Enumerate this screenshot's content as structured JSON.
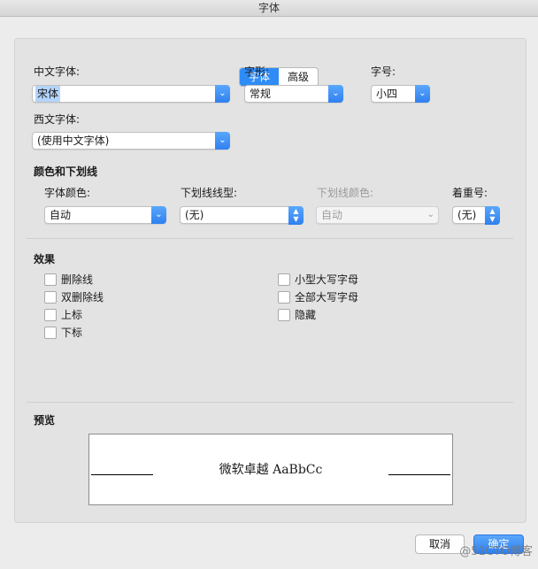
{
  "window": {
    "title": "字体"
  },
  "tabs": [
    {
      "label": "字体",
      "active": true
    },
    {
      "label": "高级",
      "active": false
    }
  ],
  "font": {
    "chinese_label": "中文字体:",
    "chinese_value": "宋体",
    "style_label": "字形:",
    "style_value": "常规",
    "size_label": "字号:",
    "size_value": "小四",
    "western_label": "西文字体:",
    "western_value": "(使用中文字体)"
  },
  "color_underline": {
    "section_title": "颜色和下划线",
    "font_color_label": "字体颜色:",
    "font_color_value": "自动",
    "underline_style_label": "下划线线型:",
    "underline_style_value": "(无)",
    "underline_color_label": "下划线颜色:",
    "underline_color_value": "自动",
    "emphasis_label": "着重号:",
    "emphasis_value": "(无)"
  },
  "effects": {
    "title": "效果",
    "left": [
      {
        "label": "删除线",
        "checked": false
      },
      {
        "label": "双删除线",
        "checked": false
      },
      {
        "label": "上标",
        "checked": false
      },
      {
        "label": "下标",
        "checked": false
      }
    ],
    "right": [
      {
        "label": "小型大写字母",
        "checked": false
      },
      {
        "label": "全部大写字母",
        "checked": false
      },
      {
        "label": "隐藏",
        "checked": false
      }
    ]
  },
  "preview": {
    "title": "预览",
    "sample_text": "微软卓越 AaBbCc"
  },
  "buttons": {
    "cancel": "取消",
    "ok": "确定"
  },
  "watermark": "@51CTO博客",
  "colors": {
    "accent": "#2f8cf7",
    "background": "#ececec"
  }
}
